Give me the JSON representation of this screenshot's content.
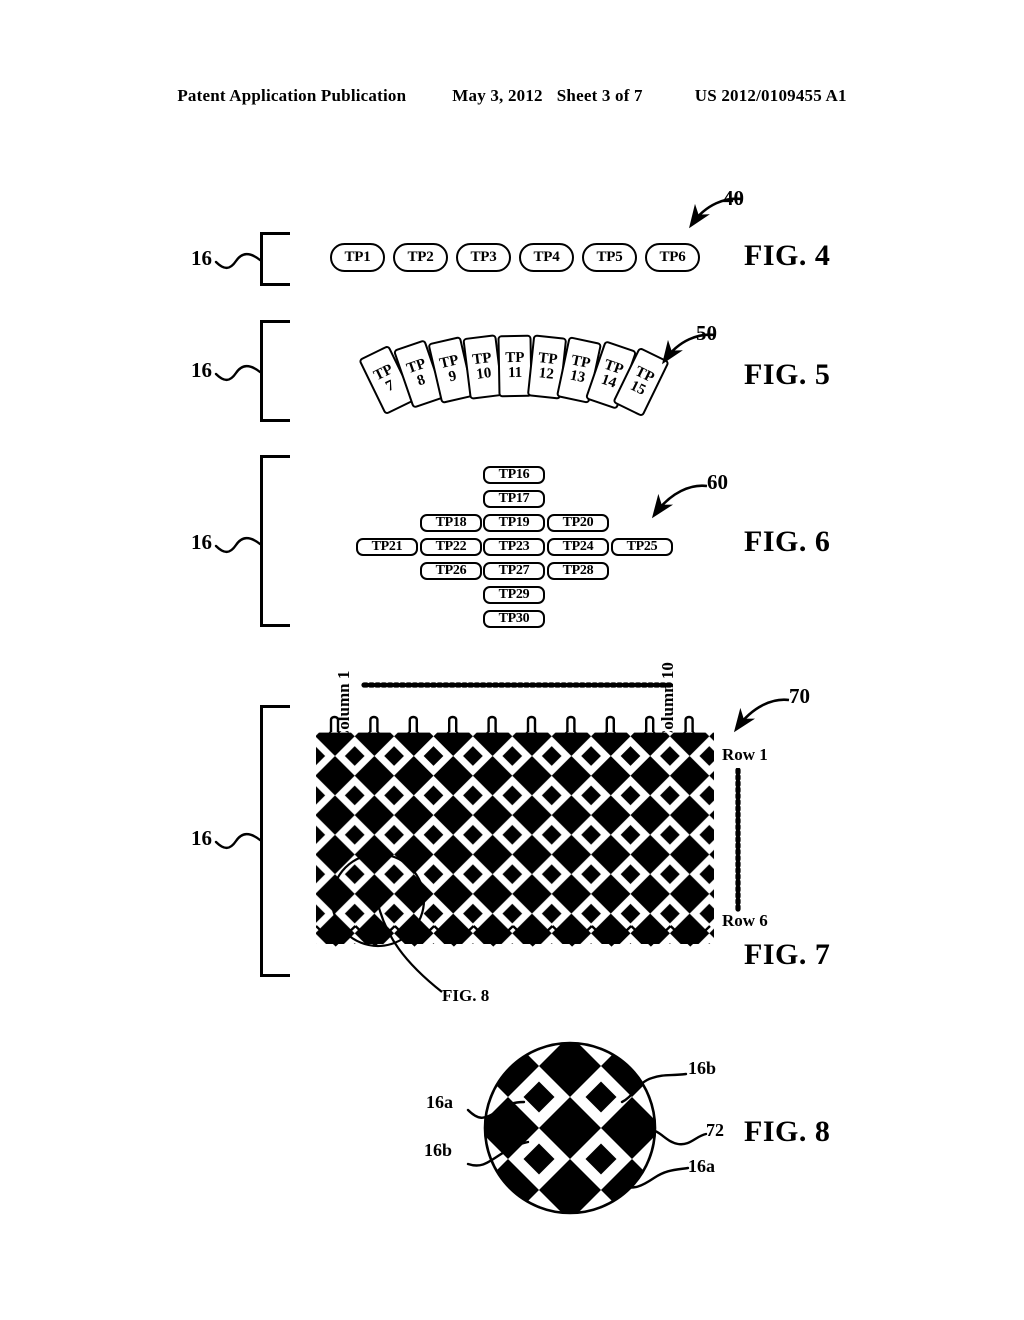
{
  "header": {
    "publication": "Patent Application Publication",
    "date": "May 3, 2012",
    "sheet": "Sheet 3 of 7",
    "patent_number": "US 2012/0109455 A1"
  },
  "figures": {
    "fig4": {
      "label": "FIG. 4",
      "ref_numeral": "40",
      "bracket_label": "16",
      "items": [
        "TP1",
        "TP2",
        "TP3",
        "TP4",
        "TP5",
        "TP6"
      ]
    },
    "fig5": {
      "label": "FIG. 5",
      "ref_numeral": "50",
      "bracket_label": "16",
      "items": [
        {
          "top": "TP",
          "bottom": "7"
        },
        {
          "top": "TP",
          "bottom": "8"
        },
        {
          "top": "TP",
          "bottom": "9"
        },
        {
          "top": "TP",
          "bottom": "10"
        },
        {
          "top": "TP",
          "bottom": "11"
        },
        {
          "top": "TP",
          "bottom": "12"
        },
        {
          "top": "TP",
          "bottom": "13"
        },
        {
          "top": "TP",
          "bottom": "14"
        },
        {
          "top": "TP",
          "bottom": "15"
        }
      ]
    },
    "fig6": {
      "label": "FIG. 6",
      "ref_numeral": "60",
      "bracket_label": "16",
      "rows": [
        [
          "TP16"
        ],
        [
          "TP17"
        ],
        [
          "TP18",
          "TP19",
          "TP20"
        ],
        [
          "TP21",
          "TP22",
          "TP23",
          "TP24",
          "TP25"
        ],
        [
          "TP26",
          "TP27",
          "TP28"
        ],
        [
          "TP29"
        ],
        [
          "TP30"
        ]
      ]
    },
    "fig7": {
      "label": "FIG. 7",
      "ref_numeral": "70",
      "bracket_label": "16",
      "column_first": "Column 1",
      "column_last": "Column 10",
      "row_first": "Row 1",
      "row_last": "Row 6",
      "detail_callout": "FIG. 8",
      "columns": 10,
      "rows": 6
    },
    "fig8": {
      "label": "FIG. 8",
      "callouts": [
        {
          "id": "16b",
          "position": "top-right"
        },
        {
          "id": "16a",
          "position": "left-upper"
        },
        {
          "id": "72",
          "position": "right-middle"
        },
        {
          "id": "16b",
          "position": "left-lower"
        },
        {
          "id": "16a",
          "position": "bottom-right"
        }
      ]
    }
  },
  "colors": {
    "ink": "#000000",
    "paper": "#ffffff"
  }
}
